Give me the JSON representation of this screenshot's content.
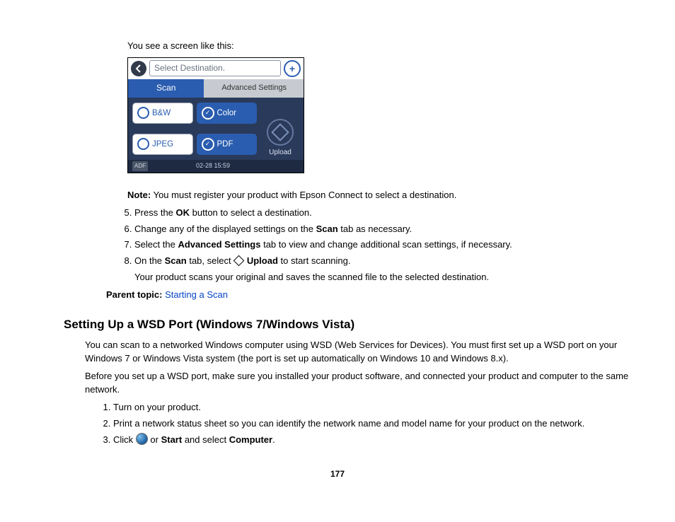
{
  "intro_line": "You see a screen like this:",
  "device": {
    "destination_placeholder": "Select Destination.",
    "tab_scan": "Scan",
    "tab_advanced": "Advanced Settings",
    "opt_bw": "B&W",
    "opt_color": "Color",
    "opt_jpeg": "JPEG",
    "opt_pdf": "PDF",
    "upload_label": "Upload",
    "adf": "ADF",
    "timestamp": "02-28 15:59"
  },
  "note_label": "Note:",
  "note_text": " You must register your product with Epson Connect to select a destination.",
  "steps_a": {
    "start": 5,
    "5_a": "Press the ",
    "5_b": "OK",
    "5_c": " button to select a destination.",
    "6_a": "Change any of the displayed settings on the ",
    "6_b": "Scan",
    "6_c": " tab as necessary.",
    "7_a": "Select the ",
    "7_b": "Advanced Settings",
    "7_c": " tab to view and change additional scan settings, if necessary.",
    "8_a": "On the ",
    "8_b": "Scan",
    "8_c": " tab, select ",
    "8_d": "Upload",
    "8_e": " to start scanning.",
    "8_sub": "Your product scans your original and saves the scanned file to the selected destination."
  },
  "parent_topic_label": "Parent topic:",
  "parent_topic_link": "Starting a Scan",
  "section_heading": "Setting Up a WSD Port (Windows 7/Windows Vista)",
  "section_p1": "You can scan to a networked Windows computer using WSD (Web Services for Devices). You must first set up a WSD port on your Windows 7 or Windows Vista system (the port is set up automatically on Windows 10 and Windows 8.x).",
  "section_p2": "Before you set up a WSD port, make sure you installed your product software, and connected your product and computer to the same network.",
  "steps_b": {
    "1": "Turn on your product.",
    "2": "Print a network status sheet so you can identify the network name and model name for your product on the network.",
    "3_a": "Click ",
    "3_b": " or ",
    "3_c": "Start",
    "3_d": " and select ",
    "3_e": "Computer",
    "3_f": "."
  },
  "page_number": "177"
}
